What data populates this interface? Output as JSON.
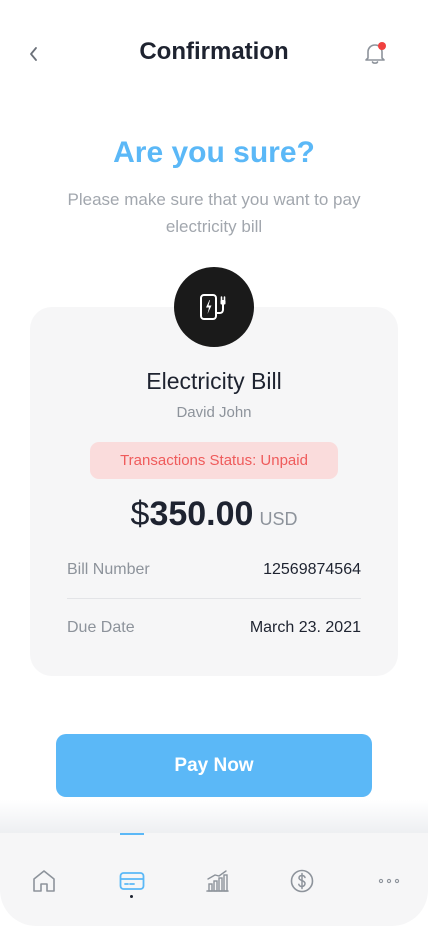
{
  "header": {
    "title": "Confirmation",
    "back_icon": "chevron-left-icon",
    "notification_icon": "bell-icon",
    "notification_badge_color": "#f0413f"
  },
  "prompt": {
    "heading": "Are you sure?",
    "message": "Please make sure that you want to pay electricity bill"
  },
  "bill": {
    "icon": "ev-plug-icon",
    "title": "Electricity Bill",
    "owner": "David John",
    "status": "Transactions Status: Unpaid",
    "currency_symbol": "$",
    "amount": "350.00",
    "currency_code": "USD",
    "details": [
      {
        "label": "Bill Number",
        "value": "12569874564"
      },
      {
        "label": "Due Date",
        "value": "March 23. 2021"
      }
    ]
  },
  "action": {
    "pay_label": "Pay Now"
  },
  "tabbar": {
    "active_index": 1,
    "tabs": [
      {
        "icon": "home-icon"
      },
      {
        "icon": "card-icon"
      },
      {
        "icon": "chart-icon"
      },
      {
        "icon": "dollar-icon"
      },
      {
        "icon": "more-icon"
      }
    ]
  },
  "colors": {
    "accent": "#5bb8f7",
    "status_text": "#ef5b5b",
    "status_bg": "#fadcdc",
    "card_bg": "#f6f6f7"
  }
}
